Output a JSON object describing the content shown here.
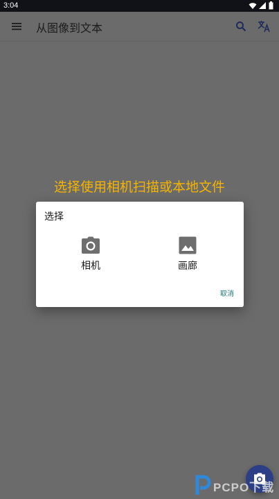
{
  "status_bar": {
    "time": "3:04",
    "icons": [
      "wifi-icon",
      "signal-icon",
      "battery-icon"
    ]
  },
  "app_bar": {
    "title": "从图像到文本",
    "icons": [
      "menu-icon",
      "search-icon",
      "translate-icon"
    ]
  },
  "hint": {
    "text": "选择使用相机扫描或本地文件",
    "color": "#f4b400"
  },
  "dialog": {
    "title": "选择",
    "options": [
      {
        "label": "相机",
        "icon": "camera-icon"
      },
      {
        "label": "画廊",
        "icon": "image-icon"
      }
    ],
    "cancel_label": "取消",
    "accent": "#1e7d7a"
  },
  "fab": {
    "icon": "camera-icon",
    "color": "#2b3e86"
  },
  "watermark": {
    "text": "PCPO下载",
    "icon": "p-logo-icon"
  }
}
